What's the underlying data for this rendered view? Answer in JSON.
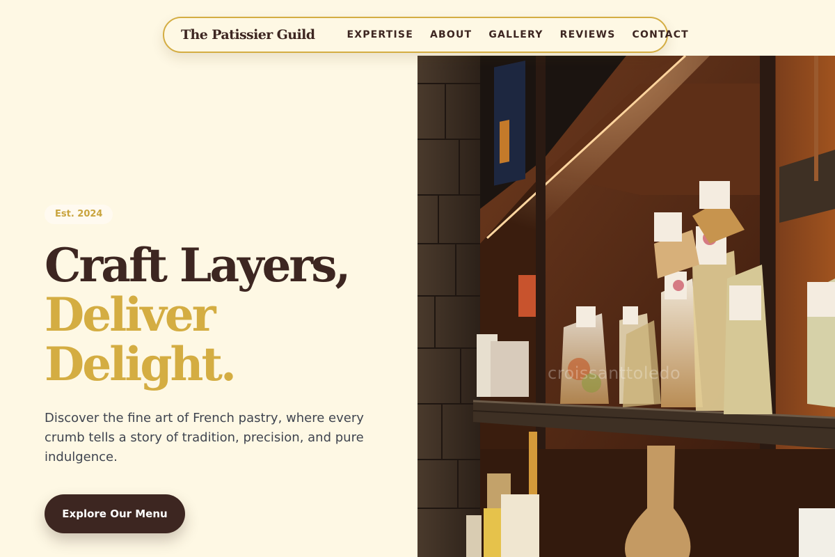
{
  "nav": {
    "brand": "The Patissier Guild",
    "links": [
      {
        "label": "EXPERTISE"
      },
      {
        "label": "ABOUT"
      },
      {
        "label": "GALLERY"
      },
      {
        "label": "REVIEWS"
      },
      {
        "label": "CONTACT"
      }
    ]
  },
  "hero": {
    "badge": "Est. 2024",
    "headline_line1": "Craft Layers,",
    "headline_line2": "Deliver",
    "headline_line3": "Delight.",
    "lede": "Discover the fine art of French pastry, where every crumb tells a story of tradition, precision, and pure indulgence.",
    "cta_label": "Explore Our Menu",
    "photo_watermark": "croissanttoledo"
  },
  "colors": {
    "background": "#fef8e4",
    "brown": "#3d2621",
    "gold": "#d4ad42",
    "body_text": "#3f444f"
  }
}
